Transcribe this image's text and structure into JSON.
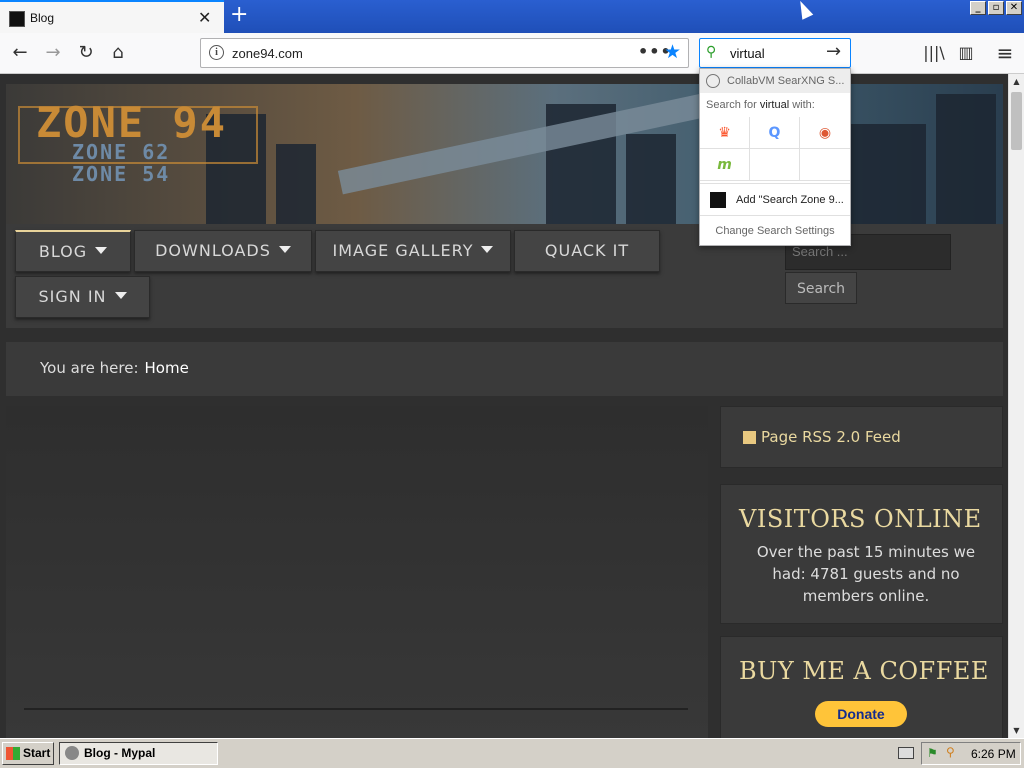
{
  "browser": {
    "tab_title": "Blog",
    "url": "zone94.com",
    "search_query": "virtual",
    "new_tab_label": "+",
    "close_tab_label": "✕",
    "more_label": "•••",
    "bookmark_label": "★",
    "back_label": "←",
    "forward_label": "→",
    "reload_label": "↻",
    "home_label": "⌂",
    "go_label": "→",
    "library_label": "|||\\",
    "sidebar_label": "▥",
    "menu_label": "≡",
    "window_buttons": [
      "_",
      "▫",
      "✕"
    ],
    "accent_color": "#0a84ff"
  },
  "search_popup": {
    "current_engine": "CollabVM SearXNG S...",
    "search_for_prefix": "Search for ",
    "search_for_term": "virtual",
    "search_for_suffix": " with:",
    "engines": [
      {
        "icon": "brave-icon",
        "glyph": "♛",
        "color": "#fb542b"
      },
      {
        "icon": "qwant-icon",
        "glyph": "Q",
        "color": "#5c97ff"
      },
      {
        "icon": "duckduckgo-icon",
        "glyph": "◉",
        "color": "#de5833"
      },
      {
        "icon": "mojeek-icon",
        "glyph": "m",
        "color": "#7ab93d"
      }
    ],
    "add_engine": "Add \"Search Zone 9...",
    "settings": "Change Search Settings"
  },
  "site": {
    "logo_main": "ZONE 94",
    "logo_sub1": "ZONE 62",
    "logo_sub2": "ZONE 54",
    "menu": [
      "BLOG",
      "DOWNLOADS",
      "IMAGE GALLERY",
      "QUACK IT",
      "SIGN IN"
    ],
    "search_placeholder": "Search ...",
    "search_button": "Search",
    "breadcrumb_prefix": "You are here:",
    "breadcrumb_current": "Home",
    "rss_label": "Page RSS 2.0 Feed",
    "visitors_title": "VISITORS ONLINE",
    "visitors_text": "Over the past 15 minutes we had: 4781 guests and no members online.",
    "coffee_title": "BUY ME A COFFEE",
    "donate_label": "Donate",
    "title_color": "#ead9a0"
  },
  "taskbar": {
    "start_label": "Start",
    "task_label": "Blog - Mypal",
    "clock": "6:26 PM"
  }
}
